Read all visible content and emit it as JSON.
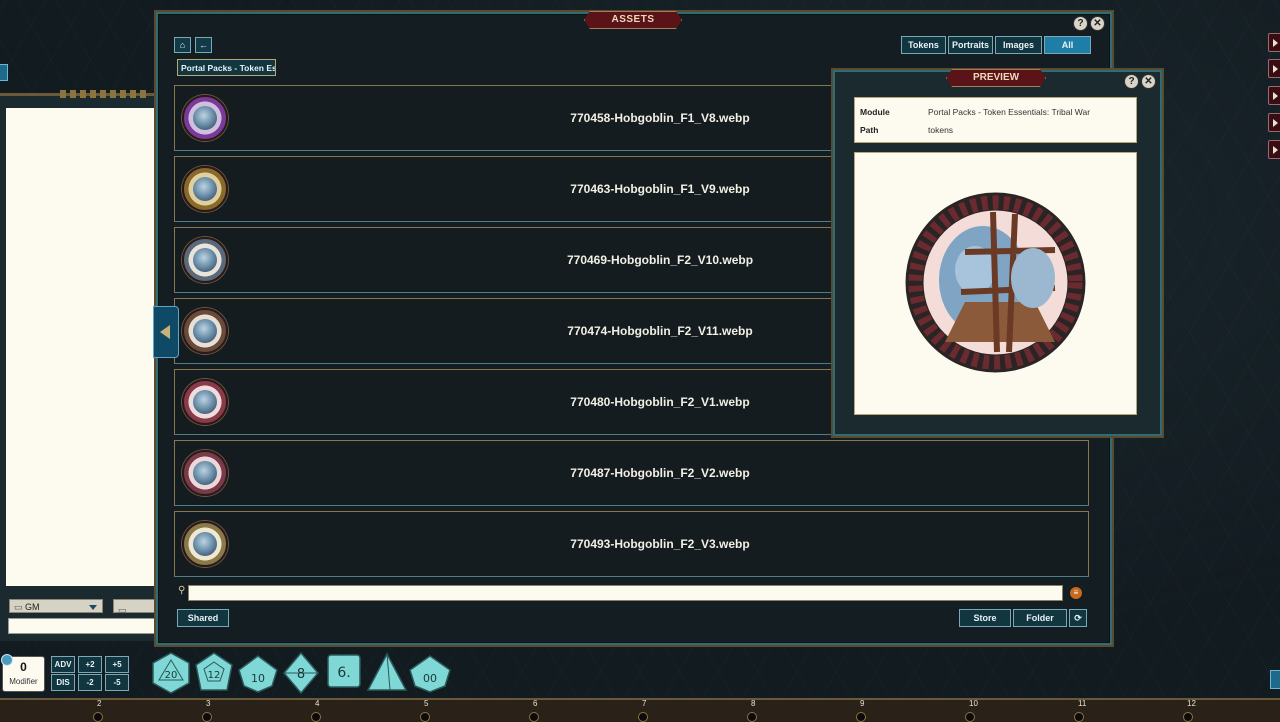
{
  "assets_window": {
    "title": "ASSETS",
    "help_label": "?",
    "close_label": "✕",
    "filters": [
      {
        "label": "Tokens",
        "active": false
      },
      {
        "label": "Portraits",
        "active": false
      },
      {
        "label": "Images",
        "active": false
      },
      {
        "label": "All",
        "active": true
      }
    ],
    "breadcrumb": "Portal Packs - Token Es",
    "items": [
      {
        "name": "770458-Hobgoblin_F1_V8.webp",
        "ring_color": "#7a3a9a"
      },
      {
        "name": "770463-Hobgoblin_F1_V9.webp",
        "ring_color": "#8a6a2a"
      },
      {
        "name": "770469-Hobgoblin_F2_V10.webp",
        "ring_color": "#5a6a7a"
      },
      {
        "name": "770474-Hobgoblin_F2_V11.webp",
        "ring_color": "#6a4a3a"
      },
      {
        "name": "770480-Hobgoblin_F2_V1.webp",
        "ring_color": "#8a3a4a"
      },
      {
        "name": "770487-Hobgoblin_F2_V2.webp",
        "ring_color": "#7a3a4a"
      },
      {
        "name": "770493-Hobgoblin_F2_V3.webp",
        "ring_color": "#8a7a4a"
      }
    ],
    "shared_label": "Shared",
    "store_label": "Store",
    "folder_label": "Folder",
    "refresh_icon": "refresh-icon"
  },
  "preview_window": {
    "title": "PREVIEW",
    "help_label": "?",
    "close_label": "✕",
    "module_label": "Module",
    "module_value": "Portal Packs - Token Essentials: Tribal War",
    "path_label": "Path",
    "path_value": "tokens"
  },
  "chat": {
    "speak_as": "GM"
  },
  "dice_bar": {
    "modifier_value": "0",
    "modifier_label": "Modifier",
    "adv_label": "ADV",
    "dis_label": "DIS",
    "plus2": "+2",
    "plus5": "+5",
    "minus2": "-2",
    "minus5": "-5",
    "dice": [
      "20",
      "12",
      "10",
      "8",
      "6.",
      "",
      "00"
    ],
    "die_color": "#7fd8d6"
  },
  "ruler": {
    "numbers": [
      "2",
      "3",
      "4",
      "5",
      "6",
      "7",
      "8",
      "9",
      "10",
      "11",
      "12"
    ]
  }
}
